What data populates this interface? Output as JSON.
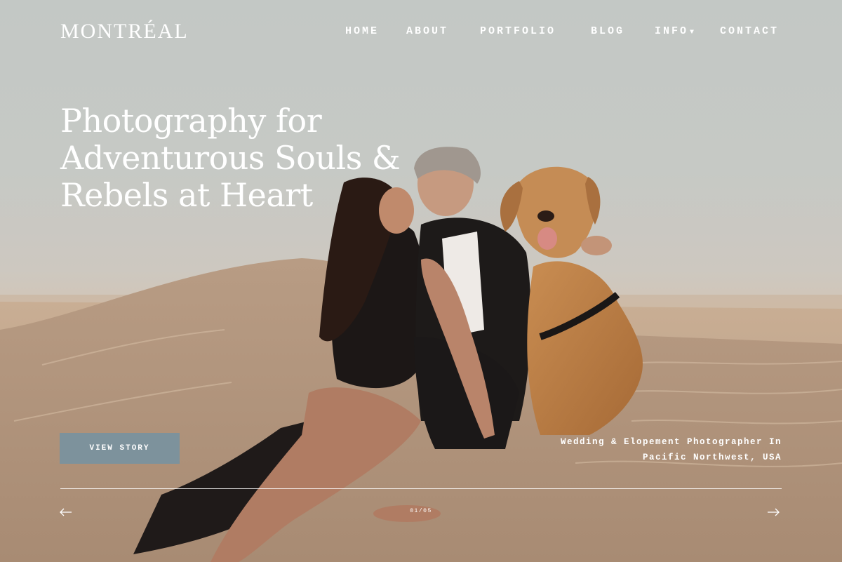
{
  "brand": {
    "logo_text": "MONTRÉAL"
  },
  "nav": {
    "items": [
      {
        "label": "HOME"
      },
      {
        "label": "ABOUT"
      },
      {
        "label": "PORTFOLIO"
      },
      {
        "label": "BLOG"
      },
      {
        "label": "INFO",
        "has_dropdown": true
      },
      {
        "label": "CONTACT"
      }
    ]
  },
  "hero": {
    "headline_lines": [
      "Photography for",
      "Adventurous Souls &",
      "Rebels at Heart"
    ],
    "cta_label": "VIEW STORY",
    "tagline_lines": [
      "Wedding & Elopement Photographer In",
      "Pacific Northwest, USA"
    ],
    "image_subject": "couple kissing with golden retriever on sand dune at sunset"
  },
  "slider": {
    "counter": "01/05",
    "prev_icon": "arrow-left-icon",
    "next_icon": "arrow-right-icon"
  },
  "colors": {
    "sky": "#c5c9c5",
    "sand": "#c2a88f",
    "button_bg": "#7d929c",
    "text": "#ffffff"
  }
}
